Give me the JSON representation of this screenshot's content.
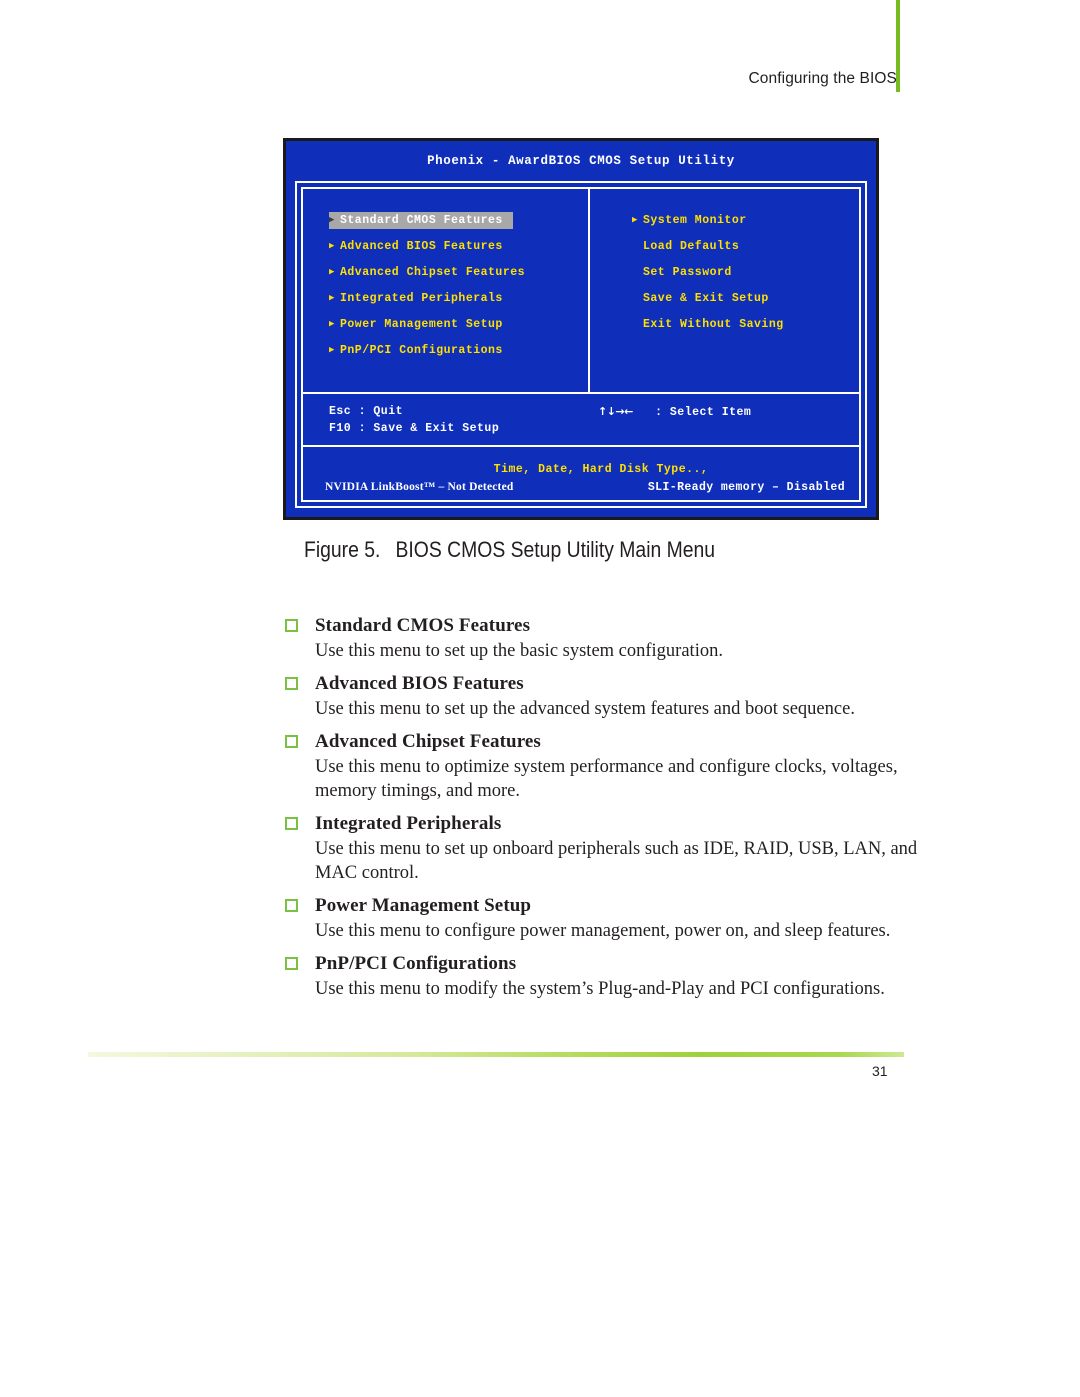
{
  "page": {
    "header_text": "Configuring the BIOS",
    "page_number": "31",
    "accent_green": "#7ac143"
  },
  "bios": {
    "title": "Phoenix - AwardBIOS CMOS Setup Utility",
    "left_menu": [
      {
        "label": "Standard CMOS Features",
        "arrow": true,
        "selected": true
      },
      {
        "label": "Advanced BIOS Features",
        "arrow": true,
        "selected": false
      },
      {
        "label": "Advanced Chipset Features",
        "arrow": true,
        "selected": false
      },
      {
        "label": "Integrated Peripherals",
        "arrow": true,
        "selected": false
      },
      {
        "label": "Power Management Setup",
        "arrow": true,
        "selected": false
      },
      {
        "label": "PnP/PCI Configurations",
        "arrow": true,
        "selected": false
      }
    ],
    "right_menu": [
      {
        "label": "System Monitor",
        "arrow": true,
        "selected": false
      },
      {
        "label": "Load Defaults",
        "arrow": false,
        "selected": false
      },
      {
        "label": "Set Password",
        "arrow": false,
        "selected": false
      },
      {
        "label": "Save & Exit Setup",
        "arrow": false,
        "selected": false
      },
      {
        "label": "Exit Without Saving",
        "arrow": false,
        "selected": false
      }
    ],
    "keys": {
      "esc": "Esc : Quit",
      "f10": "F10 : Save & Exit Setup",
      "select_arrows": "↑↓→←",
      "select_label": ": Select Item"
    },
    "status": {
      "hint": "Time, Date, Hard Disk Type..,",
      "linkboost": "NVIDIA LinkBoost™ – Not Detected",
      "sli": "SLI-Ready memory – Disabled"
    },
    "colors": {
      "background": "#0f2fbb",
      "menu_text": "#ffe000",
      "selected_bg": "#a8a8a8",
      "selected_text": "#ffffff",
      "help_text": "#ffffff"
    }
  },
  "figure": {
    "number": "Figure 5.",
    "caption": "BIOS CMOS Setup Utility Main Menu"
  },
  "entries": [
    {
      "title": "Standard CMOS Features",
      "body": "Use this menu to set up the basic system configuration."
    },
    {
      "title": "Advanced BIOS Features",
      "body": "Use this menu to set up the advanced system features and boot sequence."
    },
    {
      "title": "Advanced Chipset Features",
      "body": "Use this menu to optimize system performance and configure clocks, voltages, memory timings, and more."
    },
    {
      "title": "Integrated Peripherals",
      "body": "Use this menu to set up onboard peripherals such as IDE, RAID, USB, LAN, and MAC control."
    },
    {
      "title": "Power Management Setup",
      "body": "Use this menu to configure power management, power on, and sleep features."
    },
    {
      "title": "PnP/PCI Configurations",
      "body": "Use this menu to modify the system’s Plug-and-Play and PCI configurations."
    }
  ]
}
